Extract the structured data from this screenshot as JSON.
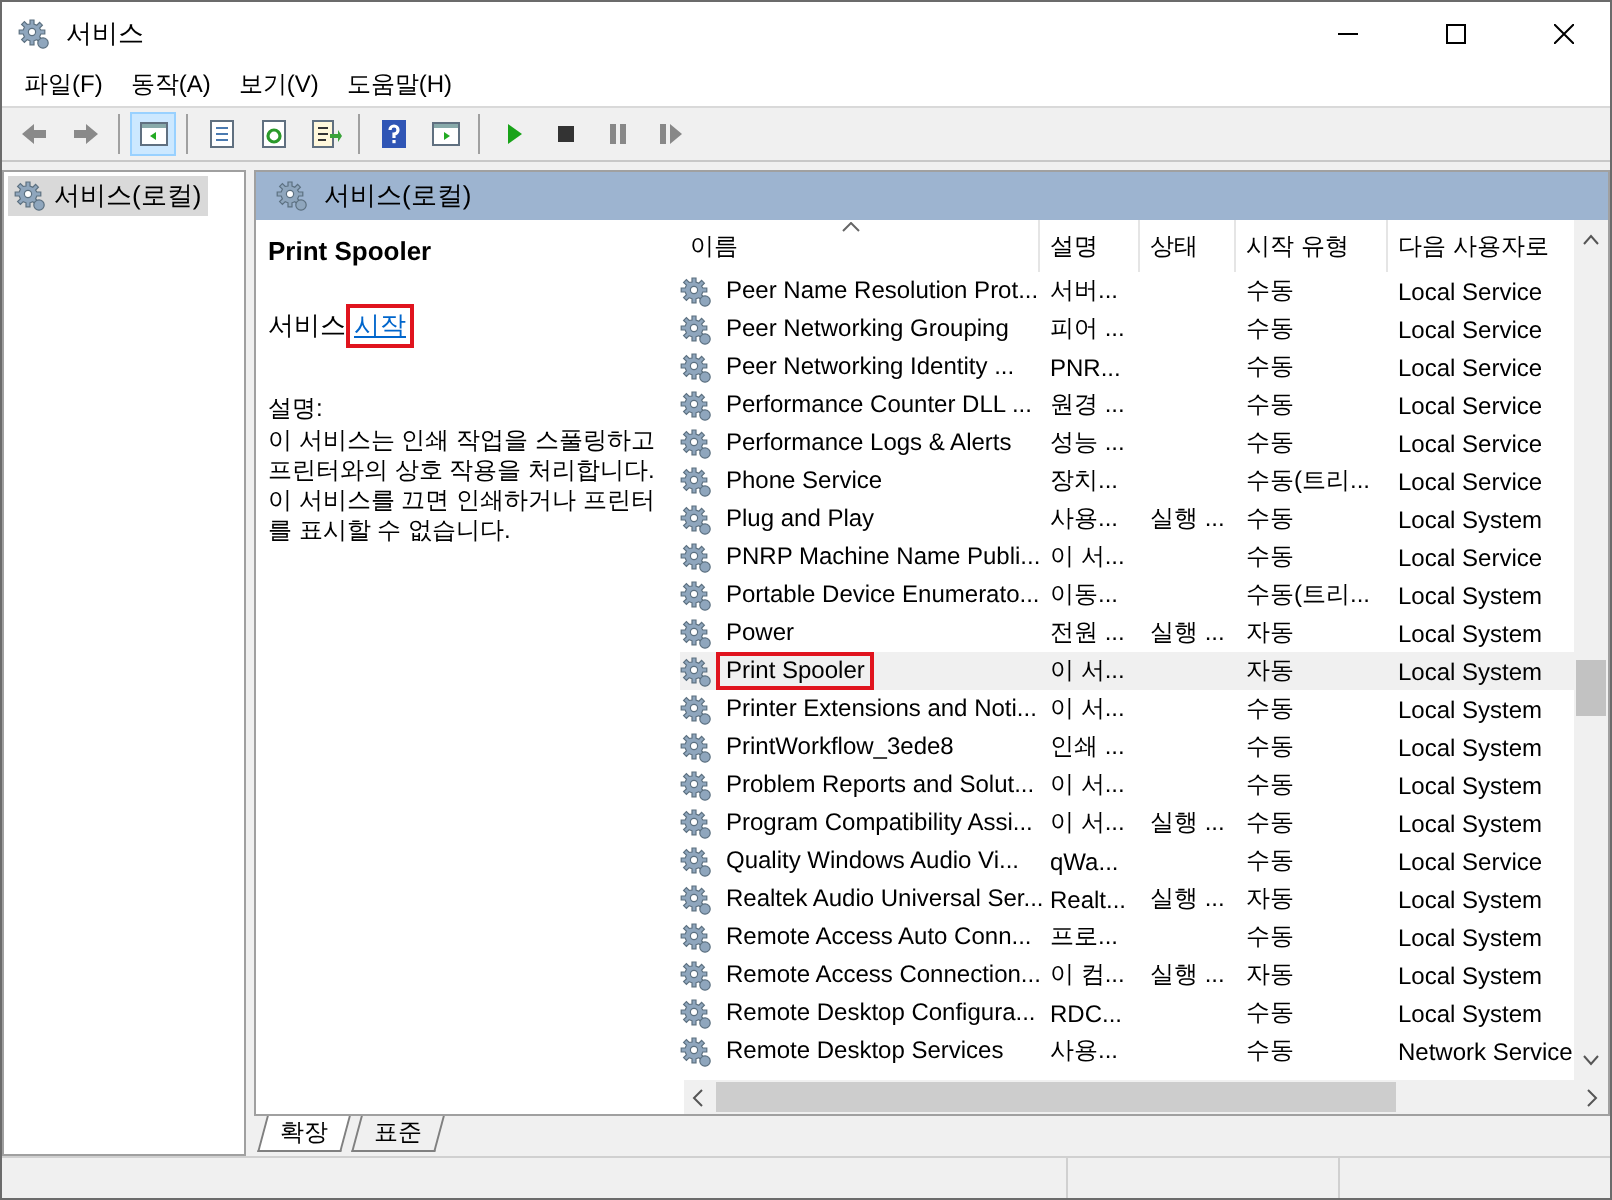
{
  "window": {
    "title": "서비스"
  },
  "menu": [
    "파일(F)",
    "동작(A)",
    "보기(V)",
    "도움말(H)"
  ],
  "toolbar": [
    {
      "kind": "back",
      "disabled": true
    },
    {
      "kind": "forward",
      "disabled": true
    },
    {
      "kind": "sep"
    },
    {
      "kind": "tree",
      "selected": true
    },
    {
      "kind": "sep"
    },
    {
      "kind": "properties"
    },
    {
      "kind": "refresh"
    },
    {
      "kind": "export"
    },
    {
      "kind": "sep"
    },
    {
      "kind": "help"
    },
    {
      "kind": "console"
    },
    {
      "kind": "sep"
    },
    {
      "kind": "play"
    },
    {
      "kind": "stop"
    },
    {
      "kind": "pause"
    },
    {
      "kind": "resume"
    }
  ],
  "tree": {
    "items": [
      {
        "label": "서비스(로컬)",
        "selected": true
      }
    ]
  },
  "pane_header": "서비스(로컬)",
  "details": {
    "title": "Print Spooler",
    "action_prefix": "서비스",
    "action_link": "시작",
    "action_outlined": true,
    "description_label": "설명:",
    "description": "이 서비스는 인쇄 작업을 스풀링하고 프린터와의 상호 작용을 처리합니다. 이 서비스를 끄면 인쇄하거나 프린터를 표시할 수 없습니다."
  },
  "table": {
    "columns": [
      {
        "label": "이름",
        "sorted": true
      },
      {
        "label": "설명",
        "sorted": false
      },
      {
        "label": "상태",
        "sorted": false
      },
      {
        "label": "시작 유형",
        "sorted": false
      },
      {
        "label": "다음 사용자로",
        "sorted": false
      }
    ],
    "rows": [
      {
        "name": "Peer Name Resolution Prot...",
        "description": "서버...",
        "status": "",
        "startup": "수동",
        "logon": "Local Service",
        "selected": false,
        "outlined": false
      },
      {
        "name": "Peer Networking Grouping",
        "description": "피어 ...",
        "status": "",
        "startup": "수동",
        "logon": "Local Service",
        "selected": false,
        "outlined": false
      },
      {
        "name": "Peer Networking Identity ...",
        "description": "PNR...",
        "status": "",
        "startup": "수동",
        "logon": "Local Service",
        "selected": false,
        "outlined": false
      },
      {
        "name": "Performance Counter DLL ...",
        "description": "원경 ...",
        "status": "",
        "startup": "수동",
        "logon": "Local Service",
        "selected": false,
        "outlined": false
      },
      {
        "name": "Performance Logs & Alerts",
        "description": "성능 ...",
        "status": "",
        "startup": "수동",
        "logon": "Local Service",
        "selected": false,
        "outlined": false
      },
      {
        "name": "Phone Service",
        "description": "장치...",
        "status": "",
        "startup": "수동(트리...",
        "logon": "Local Service",
        "selected": false,
        "outlined": false
      },
      {
        "name": "Plug and Play",
        "description": "사용...",
        "status": "실행 ...",
        "startup": "수동",
        "logon": "Local System",
        "selected": false,
        "outlined": false
      },
      {
        "name": "PNRP Machine Name Publi...",
        "description": "이 서...",
        "status": "",
        "startup": "수동",
        "logon": "Local Service",
        "selected": false,
        "outlined": false
      },
      {
        "name": "Portable Device Enumerato...",
        "description": "이동...",
        "status": "",
        "startup": "수동(트리...",
        "logon": "Local System",
        "selected": false,
        "outlined": false
      },
      {
        "name": "Power",
        "description": "전원 ...",
        "status": "실행 ...",
        "startup": "자동",
        "logon": "Local System",
        "selected": false,
        "outlined": false
      },
      {
        "name": "Print Spooler",
        "description": "이 서...",
        "status": "",
        "startup": "자동",
        "logon": "Local System",
        "selected": true,
        "outlined": true
      },
      {
        "name": "Printer Extensions and Noti...",
        "description": "이 서...",
        "status": "",
        "startup": "수동",
        "logon": "Local System",
        "selected": false,
        "outlined": false
      },
      {
        "name": "PrintWorkflow_3ede8",
        "description": "인쇄 ...",
        "status": "",
        "startup": "수동",
        "logon": "Local System",
        "selected": false,
        "outlined": false
      },
      {
        "name": "Problem Reports and Solut...",
        "description": "이 서...",
        "status": "",
        "startup": "수동",
        "logon": "Local System",
        "selected": false,
        "outlined": false
      },
      {
        "name": "Program Compatibility Assi...",
        "description": "이 서...",
        "status": "실행 ...",
        "startup": "수동",
        "logon": "Local System",
        "selected": false,
        "outlined": false
      },
      {
        "name": "Quality Windows Audio Vi...",
        "description": "qWa...",
        "status": "",
        "startup": "수동",
        "logon": "Local Service",
        "selected": false,
        "outlined": false
      },
      {
        "name": "Realtek Audio Universal Ser...",
        "description": "Realt...",
        "status": "실행 ...",
        "startup": "자동",
        "logon": "Local System",
        "selected": false,
        "outlined": false
      },
      {
        "name": "Remote Access Auto Conn...",
        "description": "프로...",
        "status": "",
        "startup": "수동",
        "logon": "Local System",
        "selected": false,
        "outlined": false
      },
      {
        "name": "Remote Access Connection...",
        "description": "이 컴...",
        "status": "실행 ...",
        "startup": "자동",
        "logon": "Local System",
        "selected": false,
        "outlined": false
      },
      {
        "name": "Remote Desktop Configura...",
        "description": "RDC...",
        "status": "",
        "startup": "수동",
        "logon": "Local System",
        "selected": false,
        "outlined": false
      },
      {
        "name": "Remote Desktop Services",
        "description": "사용...",
        "status": "",
        "startup": "수동",
        "logon": "Network Service",
        "selected": false,
        "outlined": false
      }
    ]
  },
  "view_tabs": [
    {
      "label": "확장",
      "selected": true
    },
    {
      "label": "표준",
      "selected": false
    }
  ]
}
